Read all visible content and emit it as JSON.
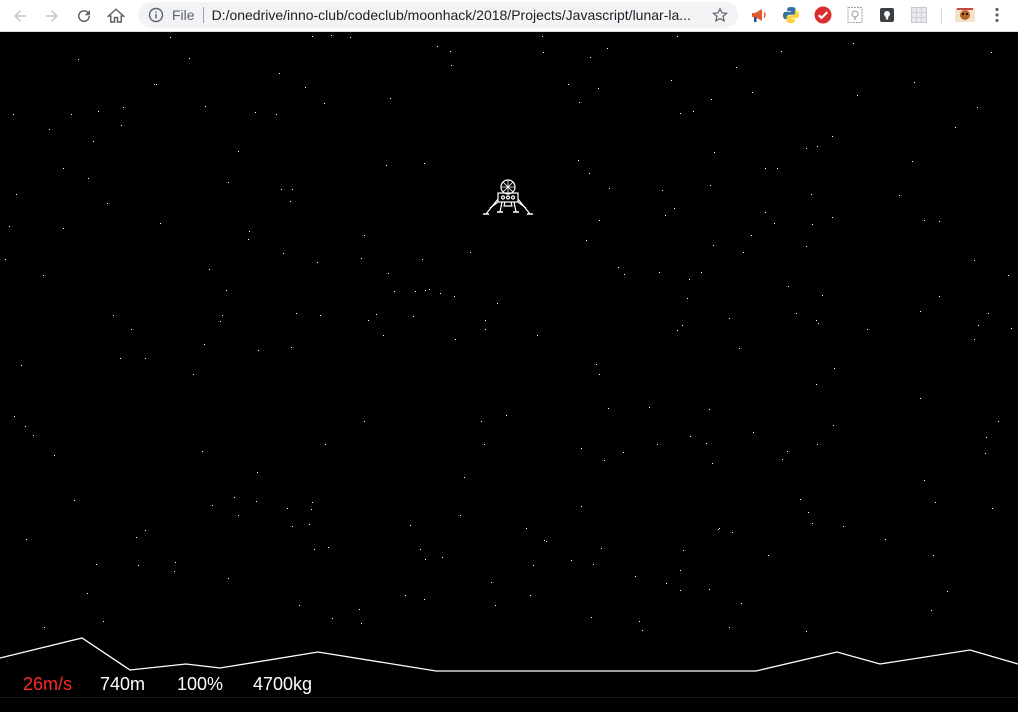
{
  "browser": {
    "scheme_label": "File",
    "url": "D:/onedrive/inno-club/codeclub/moonhack/2018/Projects/Javascript/lunar-la...",
    "icons": [
      "back-icon",
      "forward-icon",
      "reload-icon",
      "home-icon",
      "info-icon",
      "star-icon"
    ],
    "extensions": [
      "megaphone-extension-icon",
      "python-extension-icon",
      "todoist-extension-icon",
      "page-extension-icon",
      "keep-extension-icon",
      "grid-extension-icon",
      "profile-avatar-icon",
      "menu-icon"
    ]
  },
  "game": {
    "speed": "26m/s",
    "speed_color": "#ff2a2a",
    "altitude": "740m",
    "fuel": "100%",
    "mass": "4700kg",
    "stroke_color": "#ffffff",
    "background": "#000000"
  }
}
